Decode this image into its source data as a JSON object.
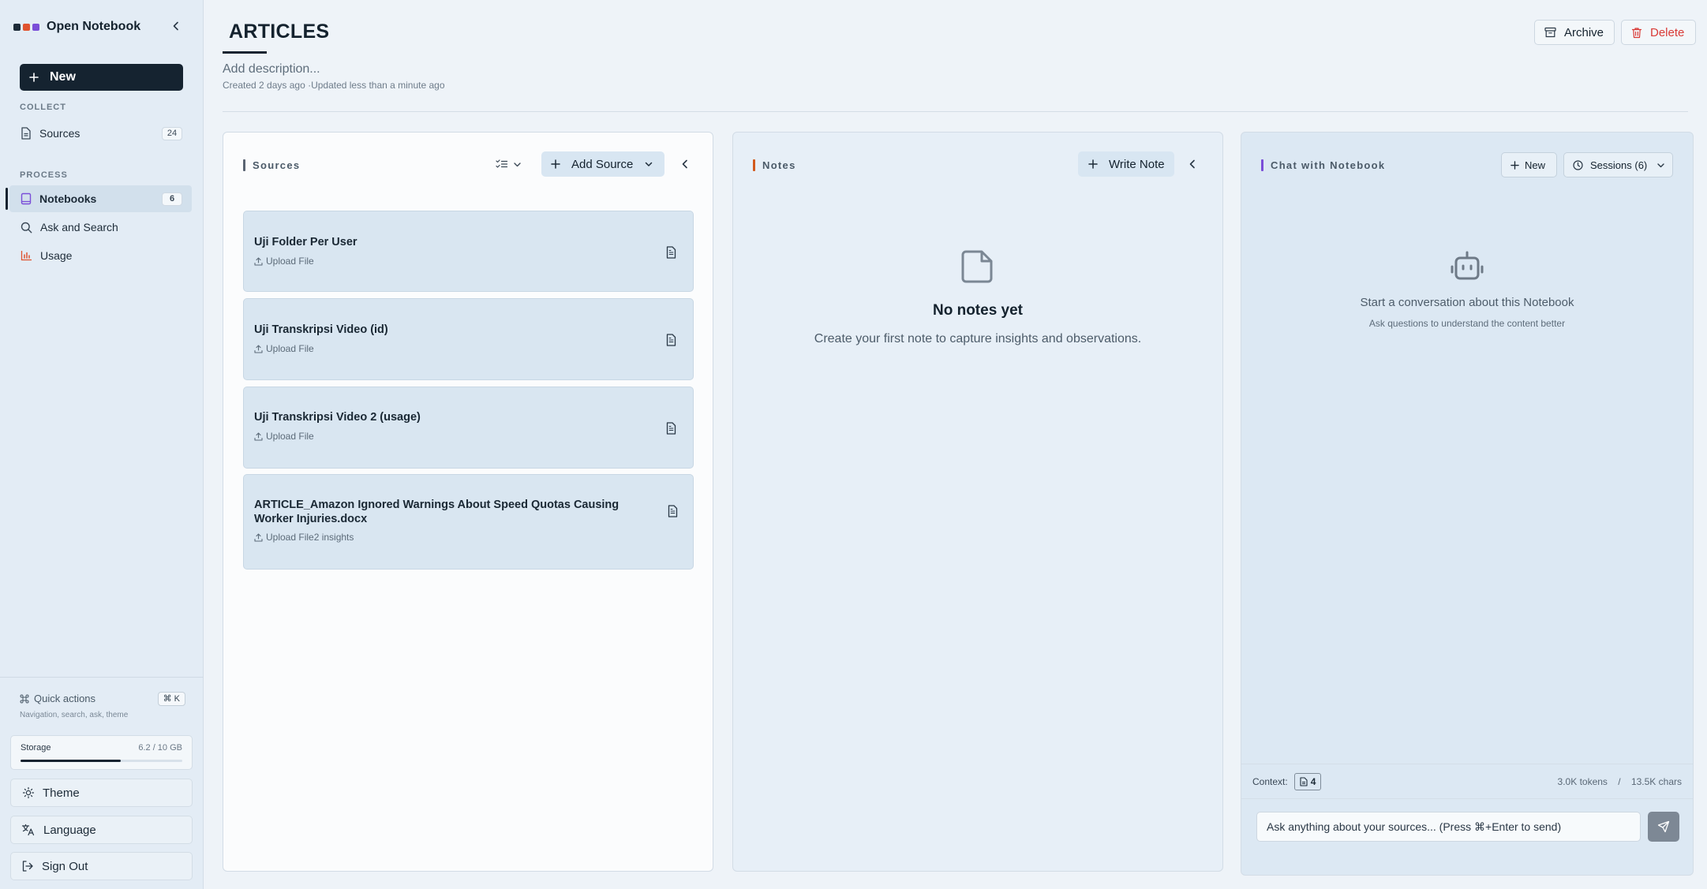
{
  "sidebar": {
    "brand": "Open Notebook",
    "brand_colors": [
      "#1d2b38",
      "#e0532f",
      "#7a4ed8"
    ],
    "new_label": "New",
    "collect_label": "COLLECT",
    "process_label": "PROCESS",
    "items": [
      {
        "label": "Sources",
        "count": "24",
        "icon": "file-icon"
      },
      {
        "label": "Notebooks",
        "count": "6",
        "icon": "book-icon",
        "active": true
      },
      {
        "label": "Ask and Search",
        "icon": "search-icon"
      },
      {
        "label": "Usage",
        "icon": "bar-chart-icon"
      }
    ],
    "quick_actions": {
      "title": "Quick actions",
      "shortcut": "⌘ K",
      "subtitle": "Navigation, search, ask, theme"
    },
    "storage": {
      "label": "Storage",
      "value": "6.2 / 10 GB",
      "fraction": 0.62
    },
    "theme_label": "Theme",
    "language_label": "Language",
    "signout_label": "Sign Out"
  },
  "header": {
    "title": "ARTICLES",
    "description_placeholder": "Add description...",
    "meta": "Created 2 days ago ·Updated less than a minute ago",
    "archive_label": "Archive",
    "delete_label": "Delete"
  },
  "sources_panel": {
    "title": "Sources",
    "accent": "#5a6472",
    "add_label": "Add Source",
    "items": [
      {
        "title": "Uji Folder Per User",
        "sub": "Upload File"
      },
      {
        "title": "Uji Transkripsi Video (id)",
        "sub": "Upload File"
      },
      {
        "title": "Uji Transkripsi Video 2 (usage)",
        "sub": "Upload File"
      },
      {
        "title": "ARTICLE_Amazon Ignored Warnings About Speed Quotas Causing Worker Injuries.docx",
        "sub": "Upload File2 insights"
      }
    ]
  },
  "notes_panel": {
    "title": "Notes",
    "accent": "#d25a1e",
    "write_label": "Write Note",
    "empty_title": "No notes yet",
    "empty_text": "Create your first note to capture insights and observations."
  },
  "chat_panel": {
    "title": "Chat with Notebook",
    "accent": "#7a4ed8",
    "new_label": "New",
    "sessions_label": "Sessions (6)",
    "empty_title": "Start a conversation about this Notebook",
    "empty_text": "Ask questions to understand the content better",
    "context_label": "Context:",
    "context_count": "4",
    "tokens": "3.0K tokens",
    "separator": "/",
    "chars": "13.5K chars",
    "input_placeholder": "Ask anything about your sources... (Press ⌘+Enter to send)"
  }
}
